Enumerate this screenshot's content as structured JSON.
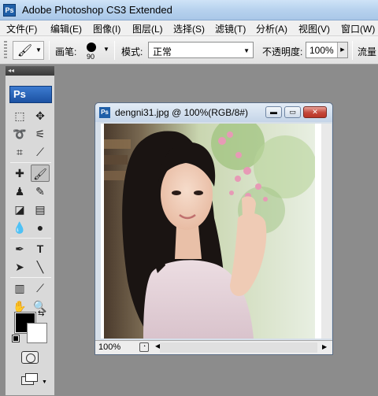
{
  "app": {
    "title": "Adobe Photoshop CS3 Extended",
    "icon": "ps-icon"
  },
  "menu": [
    "文件(F)",
    "编辑(E)",
    "图像(I)",
    "图层(L)",
    "选择(S)",
    "滤镜(T)",
    "分析(A)",
    "视图(V)",
    "窗口(W)"
  ],
  "options": {
    "brush_label": "画笔:",
    "brush_size": "90",
    "mode_label": "模式:",
    "mode_value": "正常",
    "opacity_label": "不透明度:",
    "opacity_value": "100%",
    "flow_label": "流量"
  },
  "toolbox": {
    "collapse": "◂◂",
    "logo": "Ps",
    "foreground_color": "#000000",
    "background_color": "#ffffff"
  },
  "document": {
    "title": "dengni31.jpg @ 100%(RGB/8#)",
    "zoom": "100%"
  }
}
